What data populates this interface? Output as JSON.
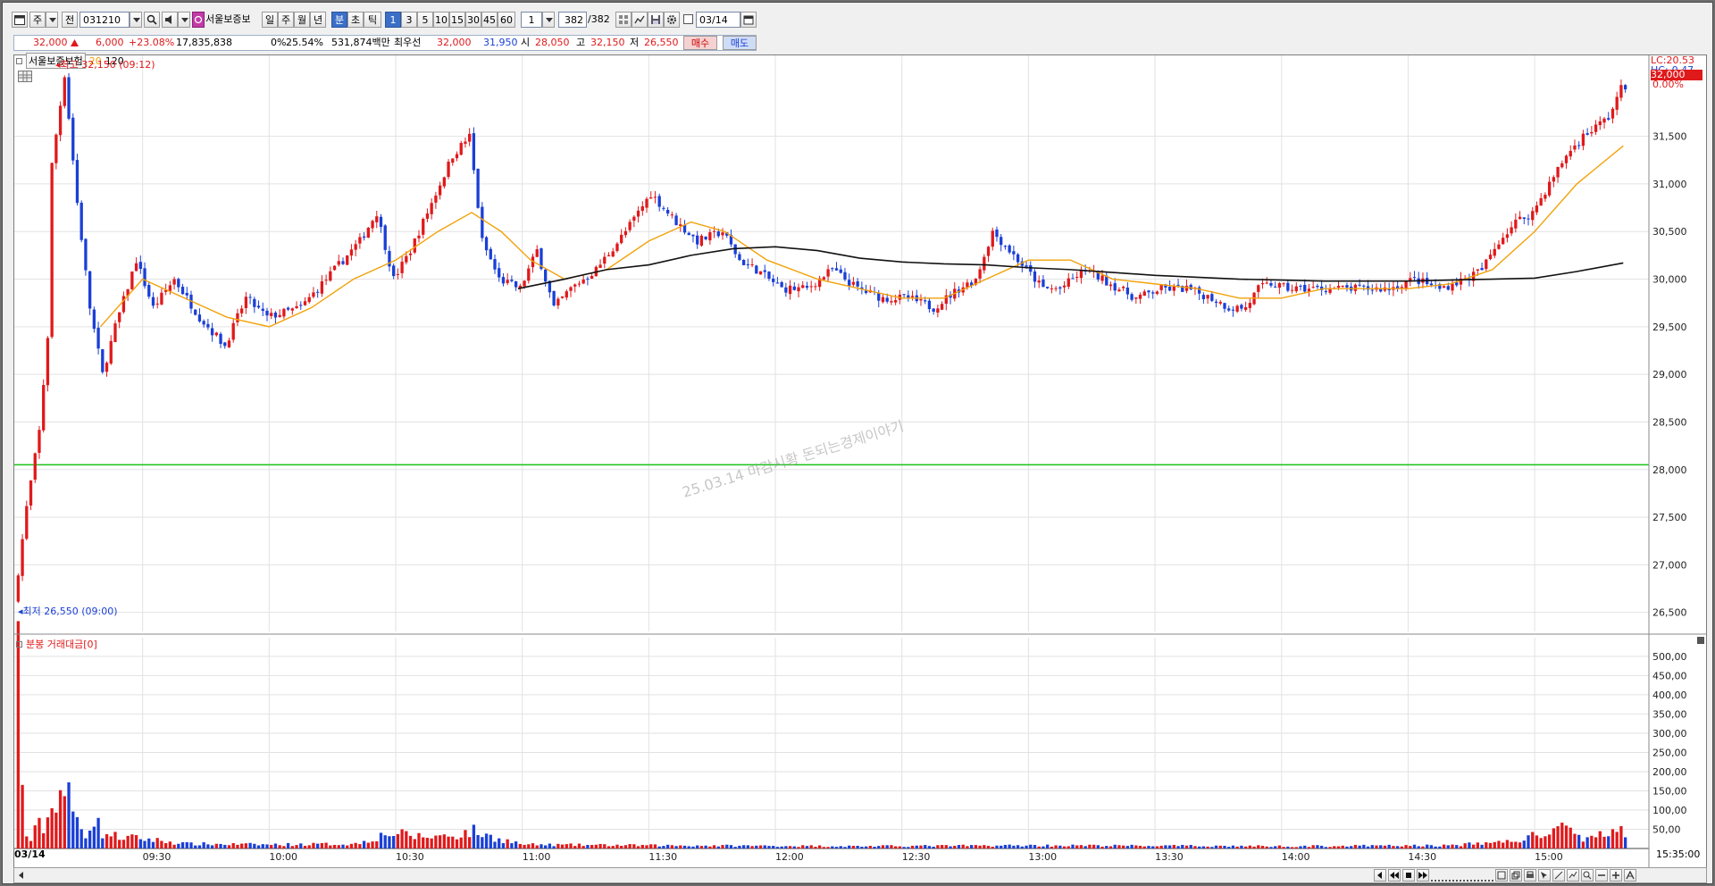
{
  "toolbar": {
    "code": "031210",
    "stock_name": "서울보증보",
    "type_label": "주",
    "prev_label": "전",
    "periods": [
      "일",
      "주",
      "월",
      "년"
    ],
    "units": [
      "분",
      "초",
      "틱"
    ],
    "minutes": [
      "1",
      "3",
      "5",
      "10",
      "15",
      "30",
      "45",
      "60"
    ],
    "selected_unit": "분",
    "selected_minute": "1",
    "interval_value": "1",
    "count_value": "382",
    "count_total": "/382",
    "date_value": "03/14"
  },
  "quote": {
    "price": "32,000",
    "change": "6,000",
    "change_pct": "+23.08%",
    "volume": "17,835,838",
    "rate_a": "0%",
    "rate_b": "25.54%",
    "amount": "531,874백만",
    "priority_label": "최우선",
    "ask": "32,000",
    "bid": "31,950",
    "open_label": "시",
    "open": "28,050",
    "high_label": "고",
    "high": "32,150",
    "low_label": "저",
    "low": "26,550",
    "buy_label": "매수",
    "sell_label": "매도"
  },
  "chart_header": {
    "name": "서울보증보험",
    "ma_short": "20",
    "ma_long": "120",
    "lc": "LC:20.53",
    "hc": "HC:-0.47",
    "current_price": "32,000",
    "current_pct": "0.00%",
    "high_marker": "최고 32,150 (09:12)",
    "low_marker": "최저 26,550 (09:00)",
    "watermark": "25.03.14 마감시황 돈되는경제이야기",
    "volume_title": "분봉 거래대금[0]",
    "date_label": "03/14",
    "end_time": "15:35:00"
  },
  "chart_data": {
    "type": "candlestick",
    "price_ticks": [
      "26,500",
      "27,000",
      "27,500",
      "28,000",
      "28,500",
      "29,000",
      "29,500",
      "30,000",
      "30,500",
      "31,000",
      "31,500"
    ],
    "price_tick_values": [
      26500,
      27000,
      27500,
      28000,
      28500,
      29000,
      29500,
      30000,
      30500,
      31000,
      31500
    ],
    "ylim": [
      26300,
      32350
    ],
    "volume_ticks": [
      "50,00",
      "100,00",
      "150,00",
      "200,00",
      "250,00",
      "300,00",
      "350,00",
      "400,00",
      "450,00",
      "500,00"
    ],
    "volume_tick_values": [
      50,
      100,
      150,
      200,
      250,
      300,
      350,
      400,
      450,
      500
    ],
    "volume_ylim": [
      0,
      530
    ],
    "time_labels": [
      "09:30",
      "10:00",
      "10:30",
      "11:00",
      "11:30",
      "12:00",
      "12:30",
      "13:00",
      "13:30",
      "14:00",
      "14:30",
      "15:00"
    ],
    "time_label_minutes": [
      30,
      60,
      90,
      120,
      150,
      180,
      210,
      240,
      270,
      300,
      330,
      360
    ],
    "session_minutes": 382,
    "green_line": 28050,
    "price_keyframes": [
      [
        0,
        26600
      ],
      [
        3,
        27600
      ],
      [
        6,
        28400
      ],
      [
        8,
        29400
      ],
      [
        9,
        31200
      ],
      [
        12,
        32150
      ],
      [
        15,
        30800
      ],
      [
        18,
        29700
      ],
      [
        21,
        29000
      ],
      [
        24,
        29500
      ],
      [
        29,
        30200
      ],
      [
        33,
        29700
      ],
      [
        38,
        30000
      ],
      [
        44,
        29600
      ],
      [
        50,
        29300
      ],
      [
        55,
        29800
      ],
      [
        60,
        29600
      ],
      [
        68,
        29700
      ],
      [
        76,
        30100
      ],
      [
        82,
        30400
      ],
      [
        86,
        30700
      ],
      [
        90,
        30000
      ],
      [
        94,
        30300
      ],
      [
        98,
        30700
      ],
      [
        104,
        31300
      ],
      [
        108,
        31500
      ],
      [
        111,
        30400
      ],
      [
        115,
        30000
      ],
      [
        120,
        29900
      ],
      [
        124,
        30300
      ],
      [
        128,
        29700
      ],
      [
        132,
        29900
      ],
      [
        138,
        30100
      ],
      [
        145,
        30500
      ],
      [
        151,
        30900
      ],
      [
        157,
        30600
      ],
      [
        162,
        30400
      ],
      [
        168,
        30500
      ],
      [
        172,
        30200
      ],
      [
        176,
        30100
      ],
      [
        182,
        29900
      ],
      [
        188,
        29900
      ],
      [
        194,
        30100
      ],
      [
        200,
        29900
      ],
      [
        206,
        29800
      ],
      [
        212,
        29800
      ],
      [
        218,
        29700
      ],
      [
        224,
        29900
      ],
      [
        228,
        30000
      ],
      [
        232,
        30500
      ],
      [
        236,
        30300
      ],
      [
        240,
        30100
      ],
      [
        244,
        29900
      ],
      [
        248,
        29900
      ],
      [
        254,
        30100
      ],
      [
        258,
        30000
      ],
      [
        262,
        29900
      ],
      [
        266,
        29800
      ],
      [
        272,
        29900
      ],
      [
        278,
        29900
      ],
      [
        284,
        29800
      ],
      [
        288,
        29700
      ],
      [
        292,
        29700
      ],
      [
        295,
        29900
      ],
      [
        298,
        29950
      ],
      [
        302,
        29900
      ],
      [
        306,
        29900
      ],
      [
        312,
        29900
      ],
      [
        318,
        29900
      ],
      [
        322,
        29900
      ],
      [
        326,
        29900
      ],
      [
        332,
        30000
      ],
      [
        338,
        29900
      ],
      [
        344,
        30000
      ],
      [
        348,
        30100
      ],
      [
        352,
        30400
      ],
      [
        356,
        30600
      ],
      [
        360,
        30700
      ],
      [
        364,
        31000
      ],
      [
        368,
        31300
      ],
      [
        372,
        31500
      ],
      [
        378,
        31700
      ],
      [
        381,
        32000
      ]
    ],
    "ma20": [
      [
        20,
        29500
      ],
      [
        30,
        30000
      ],
      [
        40,
        29800
      ],
      [
        50,
        29600
      ],
      [
        60,
        29500
      ],
      [
        70,
        29700
      ],
      [
        80,
        30000
      ],
      [
        90,
        30200
      ],
      [
        100,
        30500
      ],
      [
        108,
        30700
      ],
      [
        115,
        30500
      ],
      [
        122,
        30200
      ],
      [
        130,
        30000
      ],
      [
        140,
        30100
      ],
      [
        150,
        30400
      ],
      [
        160,
        30600
      ],
      [
        168,
        30500
      ],
      [
        178,
        30200
      ],
      [
        190,
        30000
      ],
      [
        200,
        29900
      ],
      [
        210,
        29800
      ],
      [
        220,
        29800
      ],
      [
        230,
        30000
      ],
      [
        240,
        30200
      ],
      [
        250,
        30200
      ],
      [
        260,
        30000
      ],
      [
        270,
        29950
      ],
      [
        280,
        29900
      ],
      [
        290,
        29800
      ],
      [
        300,
        29800
      ],
      [
        310,
        29900
      ],
      [
        320,
        29900
      ],
      [
        330,
        29900
      ],
      [
        340,
        29950
      ],
      [
        350,
        30100
      ],
      [
        360,
        30500
      ],
      [
        370,
        31000
      ],
      [
        381,
        31400
      ]
    ],
    "ma120": [
      [
        119,
        29900
      ],
      [
        130,
        30000
      ],
      [
        140,
        30100
      ],
      [
        150,
        30150
      ],
      [
        160,
        30250
      ],
      [
        170,
        30320
      ],
      [
        180,
        30340
      ],
      [
        190,
        30300
      ],
      [
        200,
        30220
      ],
      [
        210,
        30180
      ],
      [
        220,
        30160
      ],
      [
        230,
        30150
      ],
      [
        240,
        30120
      ],
      [
        250,
        30100
      ],
      [
        260,
        30070
      ],
      [
        270,
        30040
      ],
      [
        280,
        30020
      ],
      [
        290,
        30000
      ],
      [
        300,
        29990
      ],
      [
        310,
        29980
      ],
      [
        320,
        29980
      ],
      [
        330,
        29980
      ],
      [
        340,
        29990
      ],
      [
        350,
        30000
      ],
      [
        360,
        30010
      ],
      [
        370,
        30080
      ],
      [
        381,
        30170
      ]
    ],
    "volume_keyframes": [
      [
        0,
        500
      ],
      [
        1,
        160
      ],
      [
        2,
        35
      ],
      [
        3,
        20
      ],
      [
        4,
        45
      ],
      [
        5,
        60
      ],
      [
        6,
        55
      ],
      [
        8,
        100
      ],
      [
        9,
        145
      ],
      [
        10,
        150
      ],
      [
        11,
        145
      ],
      [
        12,
        130
      ],
      [
        13,
        95
      ],
      [
        14,
        70
      ],
      [
        15,
        55
      ],
      [
        16,
        40
      ],
      [
        18,
        80
      ],
      [
        20,
        40
      ],
      [
        24,
        30
      ],
      [
        30,
        25
      ],
      [
        40,
        12
      ],
      [
        60,
        10
      ],
      [
        80,
        12
      ],
      [
        88,
        40
      ],
      [
        96,
        30
      ],
      [
        104,
        35
      ],
      [
        108,
        45
      ],
      [
        112,
        30
      ],
      [
        120,
        10
      ],
      [
        150,
        8
      ],
      [
        200,
        6
      ],
      [
        240,
        8
      ],
      [
        270,
        7
      ],
      [
        300,
        6
      ],
      [
        340,
        8
      ],
      [
        355,
        20
      ],
      [
        362,
        40
      ],
      [
        366,
        50
      ],
      [
        370,
        30
      ],
      [
        374,
        25
      ],
      [
        378,
        60
      ],
      [
        380,
        80
      ],
      [
        381,
        25
      ]
    ]
  }
}
